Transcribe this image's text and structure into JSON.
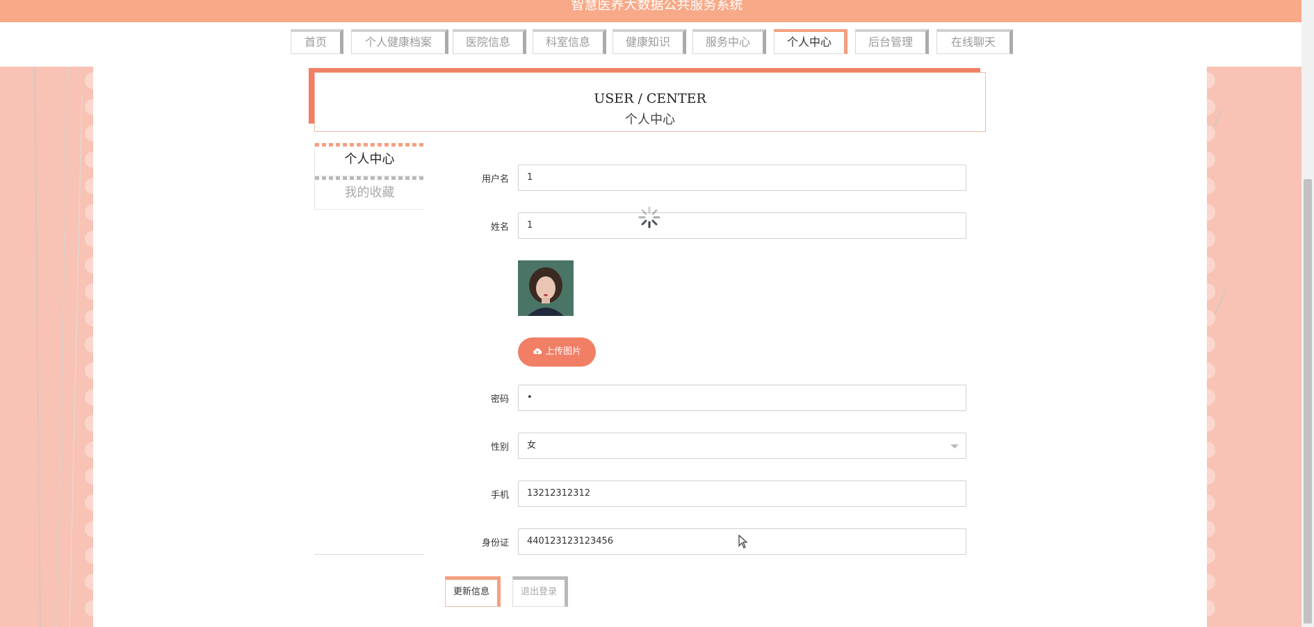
{
  "app": {
    "title": "智慧医养大数据公共服务系统"
  },
  "nav": {
    "items": [
      {
        "label": "首页"
      },
      {
        "label": "个人健康档案"
      },
      {
        "label": "医院信息"
      },
      {
        "label": "科室信息"
      },
      {
        "label": "健康知识"
      },
      {
        "label": "服务中心"
      },
      {
        "label": "个人中心",
        "active": true
      },
      {
        "label": "后台管理"
      },
      {
        "label": "在线聊天"
      }
    ]
  },
  "header": {
    "en": "USER / CENTER",
    "cn": "个人中心"
  },
  "side_menu": {
    "items": [
      {
        "label": "个人中心",
        "active": true
      },
      {
        "label": "我的收藏"
      }
    ]
  },
  "form": {
    "username": {
      "label": "用户名",
      "value": "1"
    },
    "name": {
      "label": "姓名",
      "value": "1"
    },
    "upload": {
      "label": "上传图片",
      "icon": "cloud-upload-icon"
    },
    "password": {
      "label": "密码",
      "value": "•"
    },
    "gender": {
      "label": "性别",
      "value": "女"
    },
    "phone": {
      "label": "手机",
      "value": "13212312312"
    },
    "idcard": {
      "label": "身份证",
      "value": "440123123123456"
    }
  },
  "buttons": {
    "update": "更新信息",
    "logout": "退出登录"
  },
  "colors": {
    "accent": "#f07f65",
    "banner": "#f8a987",
    "background": "#fbd6cc"
  }
}
